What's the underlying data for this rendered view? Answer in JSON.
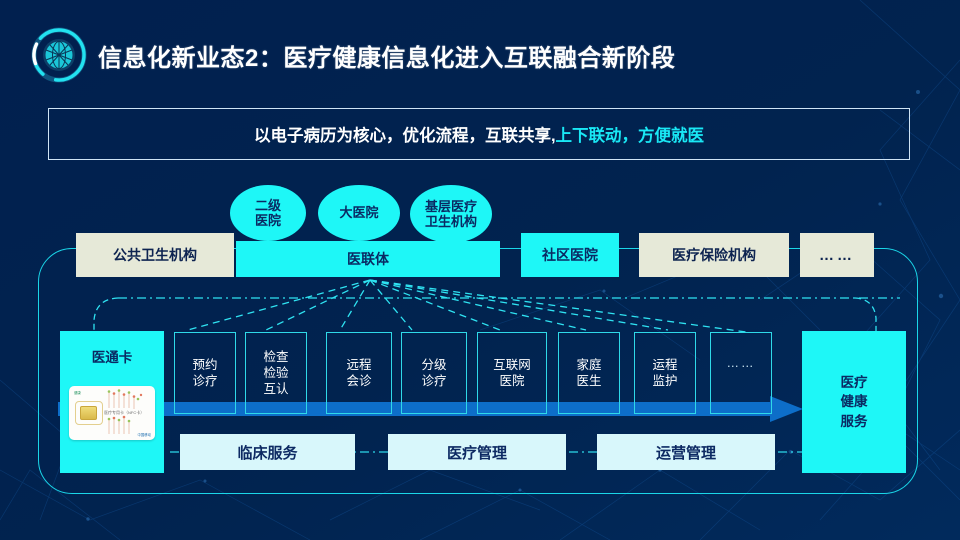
{
  "header": {
    "logo_icon": "globe-network-icon",
    "title": "信息化新业态2：医疗健康信息化进入互联融合新阶段"
  },
  "subtitle": {
    "white_part": "以电子病历为核心，优化流程，互联共享,",
    "cyan_part": "上下联动，方便就医"
  },
  "ellipses": [
    {
      "label": "二级\n医院"
    },
    {
      "label": "大医院"
    },
    {
      "label": "基层医疗\n卫生机构"
    }
  ],
  "institutions": [
    {
      "label": "公共卫生机构",
      "style": "beige"
    },
    {
      "label": "医联体",
      "style": "cyan"
    },
    {
      "label": "社区医院",
      "style": "cyan"
    },
    {
      "label": "医疗保险机构",
      "style": "beige"
    },
    {
      "label": "……",
      "style": "beige"
    }
  ],
  "card_panel": {
    "title": "医通卡",
    "card_text": "医疗专用卡（NFC卡）",
    "card_logo": "健康",
    "card_brand": "中国移动"
  },
  "services": [
    {
      "label": "预约\n诊疗"
    },
    {
      "label": "检查\n检验\n互认"
    },
    {
      "label": "远程\n会诊"
    },
    {
      "label": "分级\n诊疗"
    },
    {
      "label": "互联网\n医院"
    },
    {
      "label": "家庭\n医生"
    },
    {
      "label": "运程\n监护"
    },
    {
      "label": "……"
    }
  ],
  "outcome": {
    "label": "医疗\n健康\n服务"
  },
  "management": [
    {
      "label": "临床服务"
    },
    {
      "label": "医疗管理"
    },
    {
      "label": "运营管理"
    }
  ],
  "colors": {
    "background": "#012050",
    "cyan": "#1ef7f7",
    "beige": "#e6e9d8",
    "arrow_blue": "#0d6ec9",
    "light_cyan": "#d8f7fb",
    "border_cyan": "#2fd9e8"
  }
}
